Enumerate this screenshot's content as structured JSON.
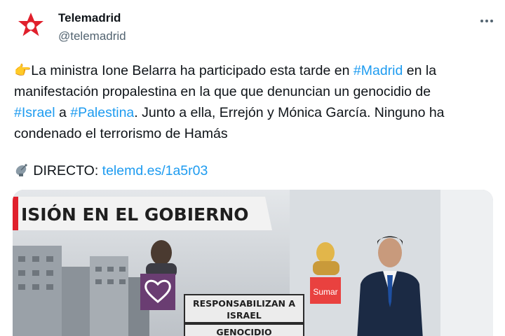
{
  "author": {
    "display_name": "Telemadrid",
    "handle": "@telemadrid",
    "avatar_icon": "telemadrid-star-logo",
    "brand_color": "#e0202c"
  },
  "menu": {
    "icon": "more-dots-icon"
  },
  "tweet": {
    "emoji": "👉",
    "line1_a": "La ministra Ione Belarra ha participado esta tarde en ",
    "hashtag_madrid": "#Madrid",
    "line1_b": " en la",
    "line2": "manifestación propalestina en la que que denuncian un genocidio de",
    "hashtag_israel": "#Israel",
    "line3_a": " a ",
    "hashtag_palestina": "#Palestina",
    "line3_b": ". Junto a ella, Errejón y Mónica García. Ninguno ha",
    "line4": "condenado el terrorismo de Hamás",
    "directo_icon": "satellite-dish-icon",
    "directo_label": " DIRECTO: ",
    "link": "telemd.es/1a5r03"
  },
  "media": {
    "banner": "ISIÓN EN EL GOBIERNO",
    "label_1_line1": "RESPONSABILIZAN A",
    "label_1_line2": "ISRAEL",
    "label_2": "GENOCIDIO",
    "party_logo": "Sumar",
    "heart_icon": "podemos-heart-logo"
  }
}
